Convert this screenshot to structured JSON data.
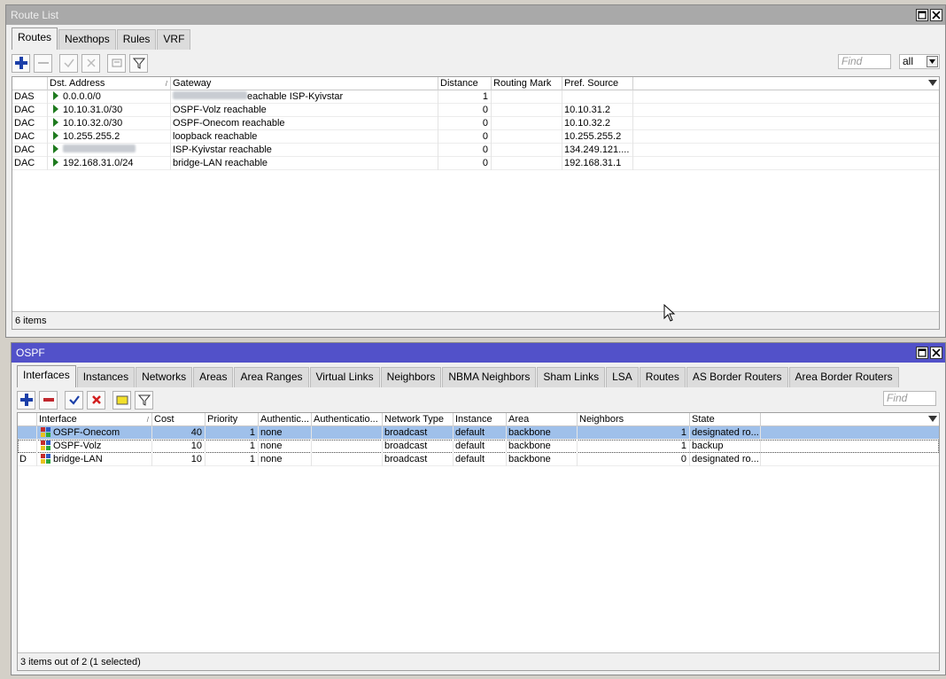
{
  "route_window": {
    "title": "Route List",
    "tabs": [
      {
        "label": "Routes"
      },
      {
        "label": "Nexthops"
      },
      {
        "label": "Rules"
      },
      {
        "label": "VRF"
      }
    ],
    "find_placeholder": "Find",
    "filter_value": "all",
    "columns": [
      "Dst. Address",
      "Gateway",
      "Distance",
      "Routing Mark",
      "Pref. Source"
    ],
    "rows": [
      {
        "flags": "DAS",
        "dst": "0.0.0.0/0",
        "gateway": "eachable ISP-Kyivstar",
        "distance": "1",
        "mark": "",
        "pref": ""
      },
      {
        "flags": "DAC",
        "dst": "10.10.31.0/30",
        "gateway": "OSPF-Volz reachable",
        "distance": "0",
        "mark": "",
        "pref": "10.10.31.2"
      },
      {
        "flags": "DAC",
        "dst": "10.10.32.0/30",
        "gateway": "OSPF-Onecom reachable",
        "distance": "0",
        "mark": "",
        "pref": "10.10.32.2"
      },
      {
        "flags": "DAC",
        "dst": "10.255.255.2",
        "gateway": "loopback reachable",
        "distance": "0",
        "mark": "",
        "pref": "10.255.255.2"
      },
      {
        "flags": "DAC",
        "dst": "",
        "gateway": "ISP-Kyivstar reachable",
        "distance": "0",
        "mark": "",
        "pref": "134.249.121...."
      },
      {
        "flags": "DAC",
        "dst": "192.168.31.0/24",
        "gateway": "bridge-LAN reachable",
        "distance": "0",
        "mark": "",
        "pref": "192.168.31.1"
      }
    ],
    "status": "6 items"
  },
  "ospf_window": {
    "title": "OSPF",
    "tabs": [
      {
        "label": "Interfaces"
      },
      {
        "label": "Instances"
      },
      {
        "label": "Networks"
      },
      {
        "label": "Areas"
      },
      {
        "label": "Area Ranges"
      },
      {
        "label": "Virtual Links"
      },
      {
        "label": "Neighbors"
      },
      {
        "label": "NBMA Neighbors"
      },
      {
        "label": "Sham Links"
      },
      {
        "label": "LSA"
      },
      {
        "label": "Routes"
      },
      {
        "label": "AS Border Routers"
      },
      {
        "label": "Area Border Routers"
      }
    ],
    "find_placeholder": "Find",
    "columns": [
      "Interface",
      "Cost",
      "Priority",
      "Authentic...",
      "Authenticatio...",
      "Network Type",
      "Instance",
      "Area",
      "Neighbors",
      "State"
    ],
    "rows": [
      {
        "flag": "",
        "iface": "OSPF-Onecom",
        "cost": "40",
        "priority": "1",
        "auth": "none",
        "authkey": "",
        "net": "broadcast",
        "inst": "default",
        "area": "backbone",
        "neighbors": "1",
        "state": "designated ro..."
      },
      {
        "flag": "",
        "iface": "OSPF-Volz",
        "cost": "10",
        "priority": "1",
        "auth": "none",
        "authkey": "",
        "net": "broadcast",
        "inst": "default",
        "area": "backbone",
        "neighbors": "1",
        "state": "backup"
      },
      {
        "flag": "D",
        "iface": "bridge-LAN",
        "cost": "10",
        "priority": "1",
        "auth": "none",
        "authkey": "",
        "net": "broadcast",
        "inst": "default",
        "area": "backbone",
        "neighbors": "0",
        "state": "designated ro..."
      }
    ],
    "status": "3 items out of 2 (1 selected)"
  },
  "icons": {
    "add": "plus-icon",
    "remove": "minus-icon",
    "enable": "check-icon",
    "disable": "cross-icon",
    "comment": "comment-icon",
    "filter": "filter-icon",
    "maximize": "maximize-icon",
    "close": "close-icon",
    "route_active": "play-arrow-icon",
    "interface": "interface-icon"
  },
  "colors": {
    "ospf_titlebar": "#5251c9",
    "route_titlebar": "#a9a9a9",
    "selected_row": "#9fc0ea",
    "active_route_arrow": "#1e7a1e"
  }
}
